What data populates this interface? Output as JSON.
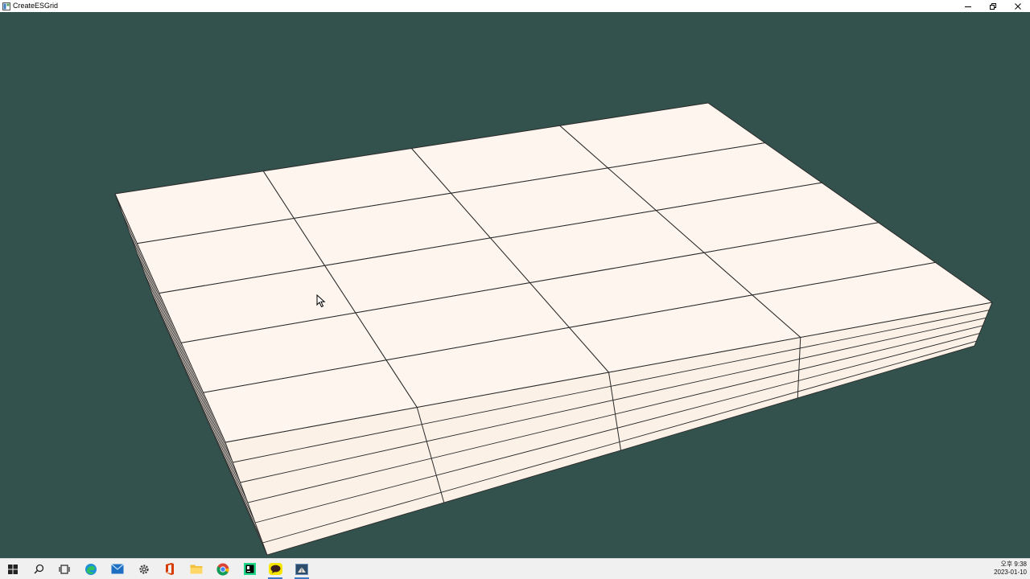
{
  "window": {
    "title": "CreateESGrid",
    "controls": [
      "minimize",
      "restore",
      "close"
    ]
  },
  "scene": {
    "background_color": "#33524d",
    "cell_color": "#fdf5ee",
    "line_color": "#2a2a2a",
    "side_color": "#fbf1e7",
    "grid_columns": 4,
    "grid_rows": 5,
    "stack_layers": 5
  },
  "taskbar": {
    "items": [
      {
        "name": "start-icon"
      },
      {
        "name": "search-icon"
      },
      {
        "name": "task-view-icon"
      },
      {
        "name": "edge-icon"
      },
      {
        "name": "mail-icon"
      },
      {
        "name": "settings-icon"
      },
      {
        "name": "office-icon"
      },
      {
        "name": "file-explorer-icon"
      },
      {
        "name": "chrome-icon"
      },
      {
        "name": "pycharm-icon"
      },
      {
        "name": "kakaotalk-icon"
      },
      {
        "name": "app-icon"
      }
    ],
    "clock": {
      "time": "오후 9:38",
      "date": "2023-01-10"
    }
  }
}
